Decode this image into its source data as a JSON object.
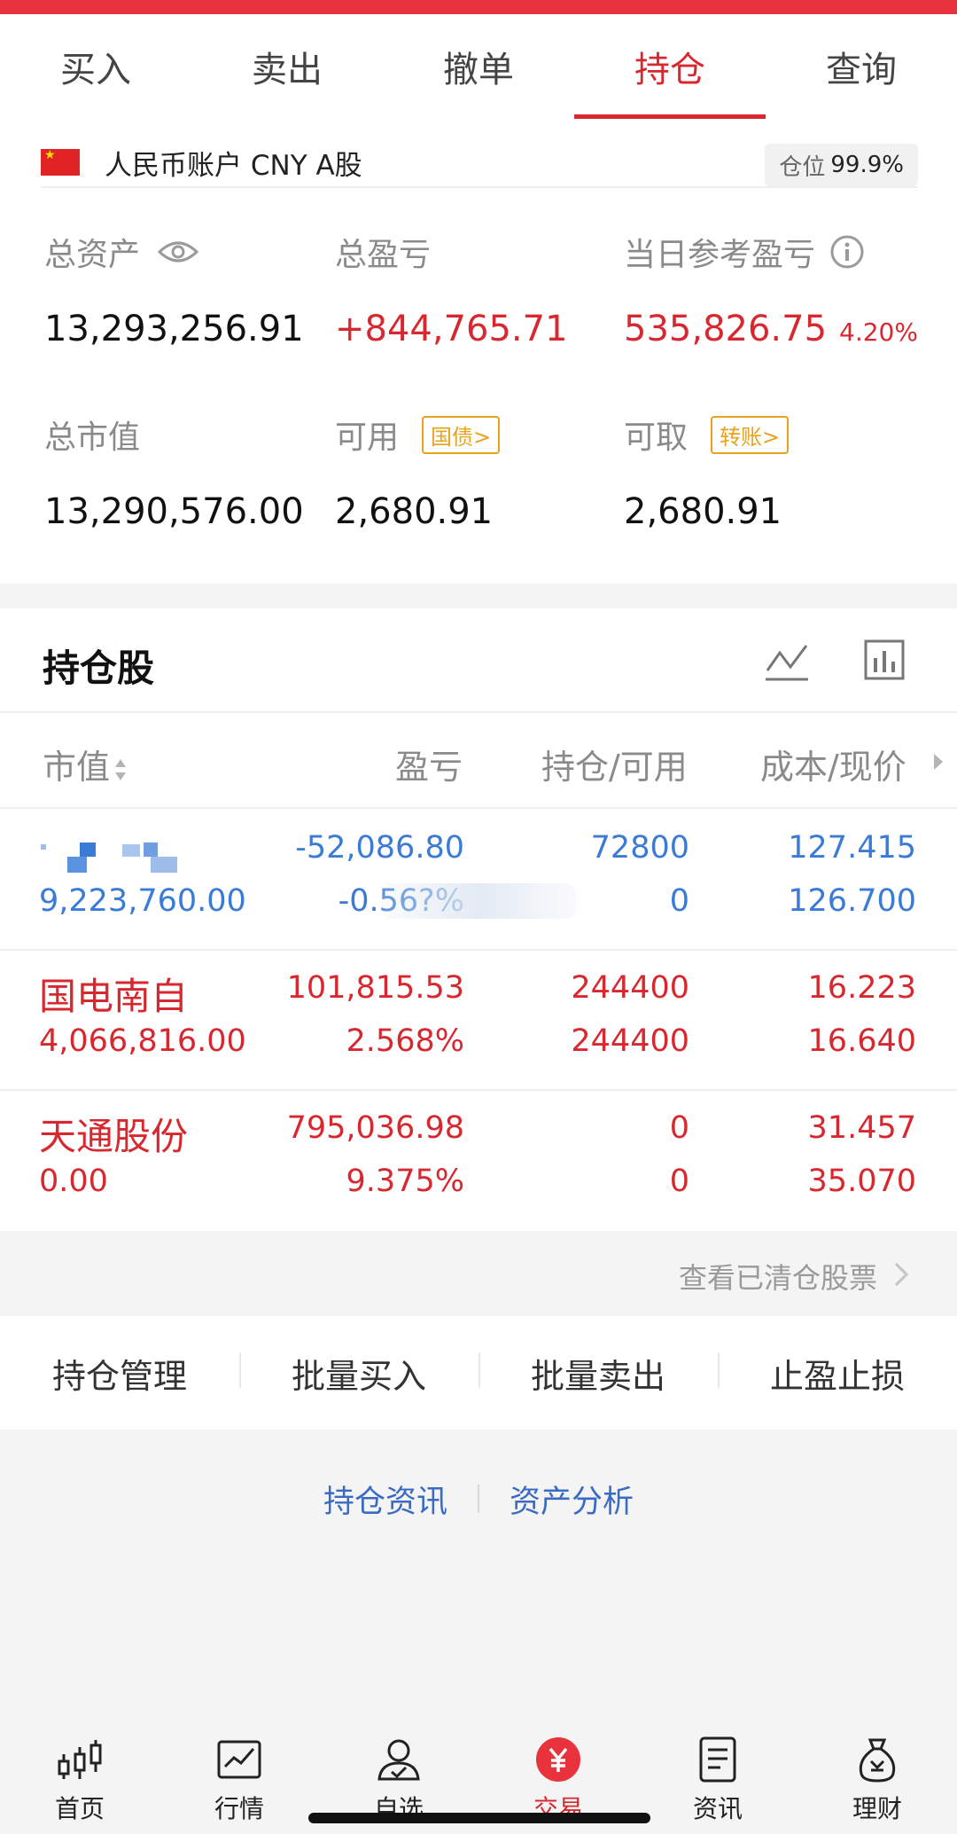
{
  "tabs": [
    {
      "label": "买入",
      "active": false
    },
    {
      "label": "卖出",
      "active": false
    },
    {
      "label": "撤单",
      "active": false
    },
    {
      "label": "持仓",
      "active": true
    },
    {
      "label": "查询",
      "active": false
    }
  ],
  "account": {
    "name": "人民币账户 CNY A股",
    "position_label": "仓位",
    "position_value": "99.9%",
    "total_assets_label": "总资产",
    "total_assets": "13,293,256.91",
    "total_pl_label": "总盈亏",
    "total_pl": "+844,765.71",
    "daily_pl_label": "当日参考盈亏",
    "daily_pl": "535,826.75",
    "daily_pl_pct": "4.20%",
    "market_value_label": "总市值",
    "market_value": "13,290,576.00",
    "available_label": "可用",
    "available_tag": "国债>",
    "available": "2,680.91",
    "withdrawable_label": "可取",
    "withdrawable_tag": "转账>",
    "withdrawable": "2,680.91"
  },
  "holdings": {
    "title": "持仓股",
    "columns": {
      "market_value": "市值",
      "pl": "盈亏",
      "position": "持仓/可用",
      "cost": "成本/现价"
    },
    "rows": [
      {
        "name": "",
        "market_value": "9,223,760.00",
        "pl": "-52,086.80",
        "pl_pct": "-0.56?%",
        "position": "72800",
        "available": "0",
        "cost": "127.415",
        "price": "126.700",
        "color": "#3a7bd5"
      },
      {
        "name": "国电南自",
        "market_value": "4,066,816.00",
        "pl": "101,815.53",
        "pl_pct": "2.568%",
        "position": "244400",
        "available": "244400",
        "cost": "16.223",
        "price": "16.640",
        "color": "#d8282f"
      },
      {
        "name": "天通股份",
        "market_value": "0.00",
        "pl": "795,036.98",
        "pl_pct": "9.375%",
        "position": "0",
        "available": "0",
        "cost": "31.457",
        "price": "35.070",
        "color": "#d8282f"
      }
    ],
    "cleared_link": "查看已清仓股票"
  },
  "actions": [
    "持仓管理",
    "批量买入",
    "批量卖出",
    "止盈止损"
  ],
  "links": [
    "持仓资讯",
    "资产分析"
  ],
  "bottom_nav": [
    {
      "label": "首页",
      "icon": "candlestick-icon"
    },
    {
      "label": "行情",
      "icon": "market-chart-icon"
    },
    {
      "label": "自选",
      "icon": "user-check-icon"
    },
    {
      "label": "交易",
      "icon": "yuan-icon",
      "active": true
    },
    {
      "label": "资讯",
      "icon": "news-doc-icon"
    },
    {
      "label": "理财",
      "icon": "money-bag-icon"
    }
  ],
  "colors": {
    "accent": "#d8282f",
    "up": "#d8282f",
    "down": "#3a7bd5",
    "tag": "#e8a21c",
    "link": "#3a6ac4"
  }
}
